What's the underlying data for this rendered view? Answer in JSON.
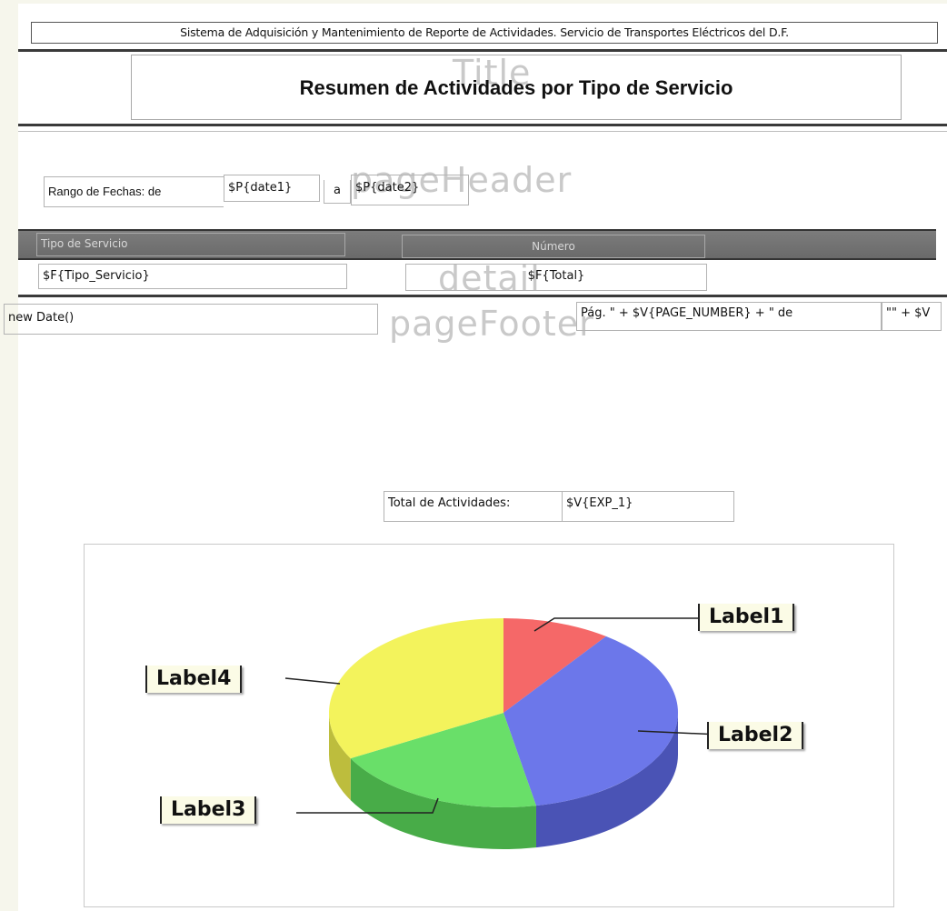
{
  "header": {
    "system_title": "Sistema de Adquisición y Mantenimiento de Reporte de Actividades. Servicio de Transportes Eléctricos del D.F.",
    "report_title": "Resumen de Actividades por Tipo de Servicio"
  },
  "band_labels": {
    "title": "Title",
    "page_header": "pageHeader",
    "detail": "detail",
    "page_footer": "pageFooter"
  },
  "date_range": {
    "label": "Rango de Fechas: de",
    "date1": "$P{date1}",
    "separator": "a",
    "date2": "$P{date2}"
  },
  "columns": {
    "tipo_servicio": "Tipo de Servicio",
    "numero": "Número"
  },
  "detail": {
    "tipo_servicio_field": "$F{Tipo_Servicio}",
    "total_field": "$F{Total}"
  },
  "footer": {
    "date_expr": "new Date()",
    "page_expr": "Pág. \" + $V{PAGE_NUMBER} + \" de",
    "page_total_expr": "\"\" + $V"
  },
  "summary": {
    "total_label": "Total de Actividades:",
    "total_value": "$V{EXP_1}"
  },
  "chart_data": {
    "type": "pie",
    "categories": [
      "Label1",
      "Label2",
      "Label3",
      "Label4"
    ],
    "values": [
      10,
      37,
      20,
      33
    ],
    "colors": [
      "#f45b5b",
      "#5f6be8",
      "#5cdc5c",
      "#f2f24e"
    ]
  }
}
